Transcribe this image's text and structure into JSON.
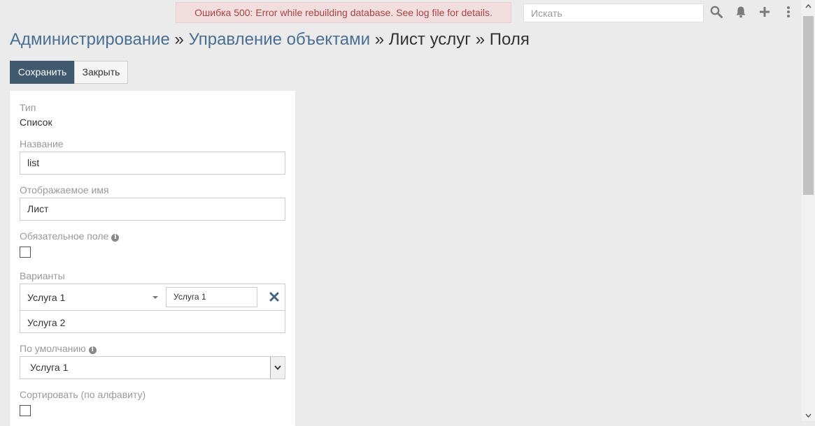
{
  "error_banner": "Ошибка 500: Error while rebuilding database. See log file for details.",
  "search": {
    "placeholder": "Искать"
  },
  "topbar_icons": [
    "search-icon",
    "bell-icon",
    "plus-icon",
    "kebab-menu-icon"
  ],
  "breadcrumb": {
    "item1": "Администрирование",
    "sep1": "»",
    "item2": "Управление объектами",
    "sep2": "»",
    "item3": "Лист услуг",
    "sep3": "»",
    "item4": "Поля"
  },
  "buttons": {
    "save": "Сохранить",
    "close": "Закрыть"
  },
  "form": {
    "type_label": "Тип",
    "type_value": "Список",
    "name_label": "Название",
    "name_value": "list",
    "display_label": "Отображаемое имя",
    "display_value": "Лист",
    "required_label": "Обязательное поле",
    "options_label": "Варианты",
    "options": [
      {
        "text": "Услуга 1",
        "translation": "Услуга 1"
      },
      {
        "text": "Услуга 2"
      }
    ],
    "default_label": "По умолчанию",
    "default_value": "Услуга 1",
    "sort_label": "Сортировать (по алфавиту)"
  },
  "colors": {
    "accent": "#40596f",
    "link": "#4a6f93",
    "error_bg": "#f2dede",
    "error_text": "#a94442"
  }
}
